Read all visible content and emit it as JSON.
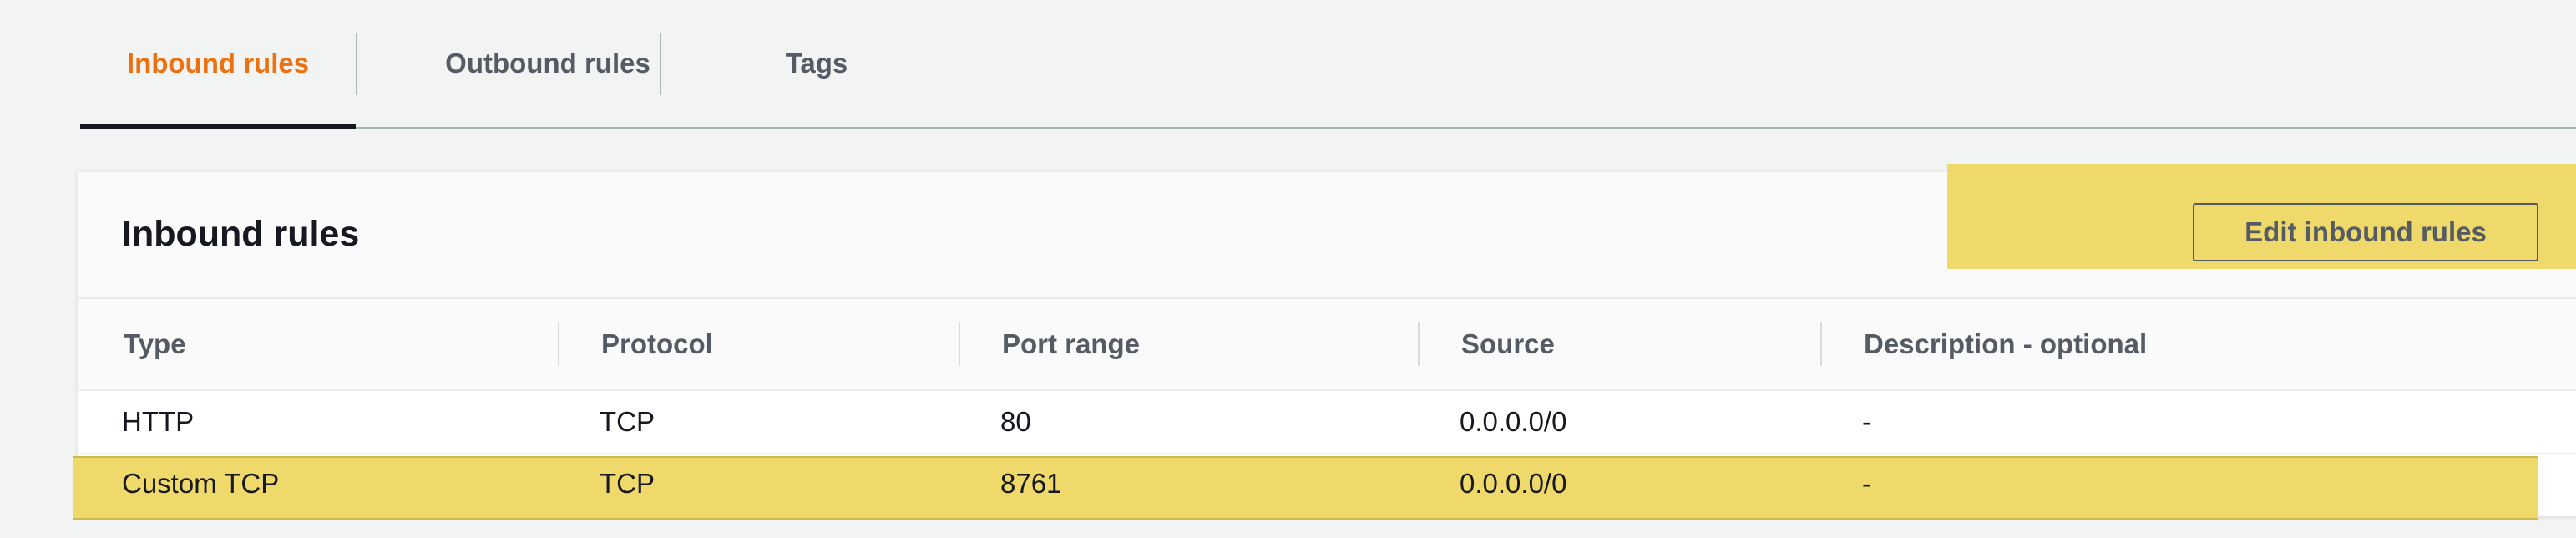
{
  "tabs": [
    {
      "label": "Inbound rules",
      "active": true
    },
    {
      "label": "Outbound rules",
      "active": false
    },
    {
      "label": "Tags",
      "active": false
    }
  ],
  "panel": {
    "title": "Inbound rules",
    "edit_button_label": "Edit inbound rules"
  },
  "table": {
    "columns": [
      "Type",
      "Protocol",
      "Port range",
      "Source",
      "Description - optional"
    ],
    "rows": [
      {
        "type": "HTTP",
        "protocol": "TCP",
        "port_range": "80",
        "source": "0.0.0.0/0",
        "description": "-",
        "highlighted": false
      },
      {
        "type": "Custom TCP",
        "protocol": "TCP",
        "port_range": "8761",
        "source": "0.0.0.0/0",
        "description": "-",
        "highlighted": true
      }
    ]
  },
  "colors": {
    "accent": "#ec7211",
    "highlight": "#efd96a",
    "text": "#16191f",
    "muted_text": "#545b64"
  }
}
